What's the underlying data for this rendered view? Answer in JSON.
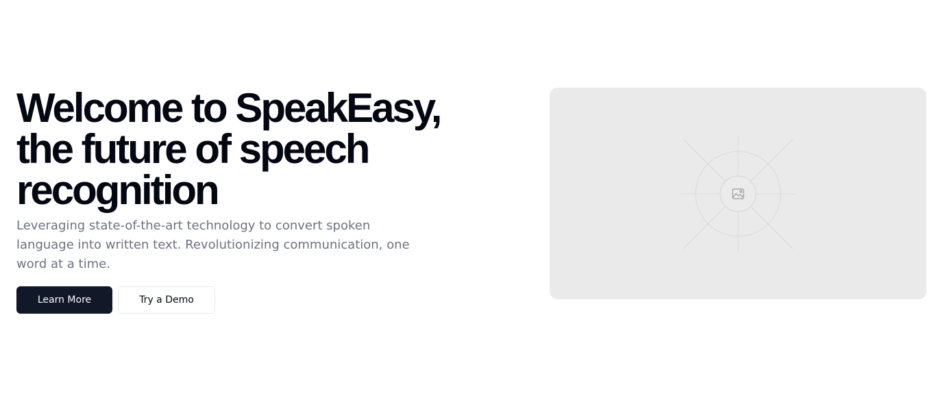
{
  "hero": {
    "headline_lines": [
      "Welcome to SpeakEasy,",
      "the future of speech",
      "recognition"
    ],
    "subtitle_lines": [
      "Leveraging state-of-the-art technology to convert spoken",
      "language into written text. Revolutionizing communication, one",
      "word at a time."
    ],
    "primary_button": "Learn More",
    "secondary_button": "Try a Demo",
    "image_icon": "image-icon"
  }
}
